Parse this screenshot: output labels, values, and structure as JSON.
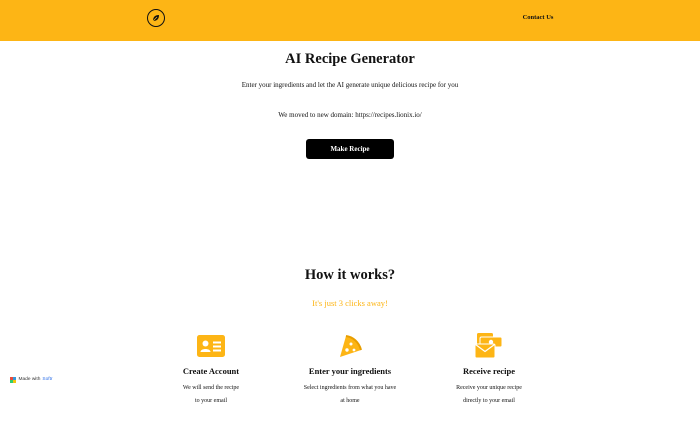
{
  "header": {
    "logo_icon": "leaf-circle-icon",
    "contact_label": "Contact Us",
    "background_color": "#FDB515"
  },
  "hero": {
    "title": "AI Recipe Generator",
    "subtitle": "Enter your ingredients and let the AI generate unique delicious recipe for you",
    "notice": "We moved to new domain: https://recipes.lionix.io/",
    "button_label": "Make Recipe"
  },
  "how_it_works": {
    "title": "How it works?",
    "subtitle": "It's just 3 clicks away!",
    "accent_color": "#FDB515",
    "steps": [
      {
        "icon": "id-card-icon",
        "title": "Create Account",
        "desc_line1": "We will send the recipe",
        "desc_line2": "to your email"
      },
      {
        "icon": "pizza-slice-icon",
        "title": "Enter your ingredients",
        "desc_line1": "Select ingredients from what you have",
        "desc_line2": "at home"
      },
      {
        "icon": "envelope-money-icon",
        "title": "Receive recipe",
        "desc_line1": "Receive your unique recipe",
        "desc_line2": "directly to your email"
      }
    ]
  },
  "badge": {
    "prefix": "Made with",
    "brand": "Softr",
    "brand_colors": [
      "#e74c3c",
      "#3498db",
      "#2ecc71",
      "#f1c40f"
    ]
  }
}
